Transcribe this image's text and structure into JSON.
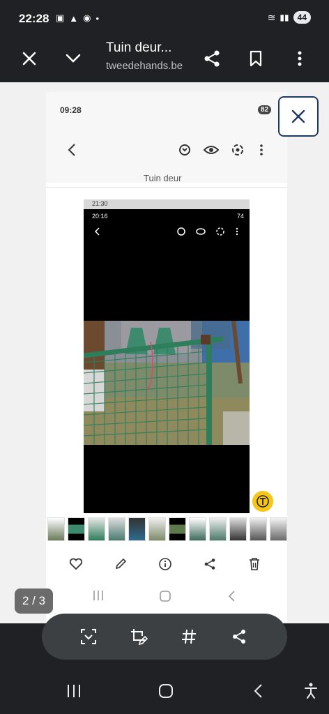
{
  "status": {
    "time": "22:28",
    "battery": "44"
  },
  "browser": {
    "title": "Tuin deur...",
    "url": "tweedehands.be"
  },
  "screenshot": {
    "status_time": "09:28",
    "battery": "82",
    "title_partial": "Tuin deur",
    "phone": {
      "time_top": "21:30",
      "time_inner": "20:16",
      "battery_inner": "74"
    }
  },
  "viewer": {
    "counter": "2 / 3"
  },
  "icons": {
    "close": "close-icon",
    "chevron": "chevron-down-icon",
    "share": "share-icon",
    "bookmark": "bookmark-icon",
    "menu": "more-vert-icon",
    "text": "text-recognition-icon"
  },
  "colors": {
    "bar": "#202124",
    "fab": "#f5c518",
    "fence": "#2e7d5b"
  }
}
